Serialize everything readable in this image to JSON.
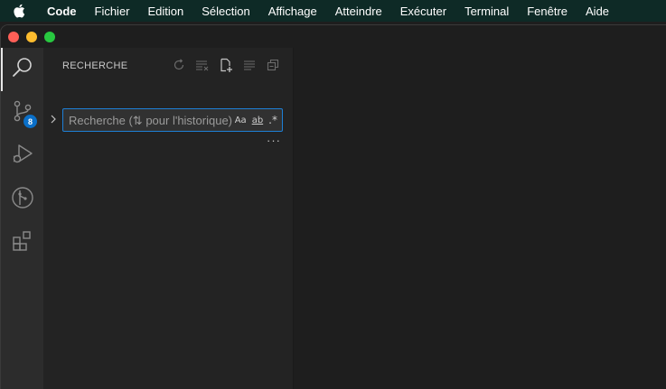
{
  "menubar": {
    "apple_icon": "apple-logo-icon",
    "items": [
      "Code",
      "Fichier",
      "Edition",
      "Sélection",
      "Affichage",
      "Atteindre",
      "Exécuter",
      "Terminal",
      "Fenêtre",
      "Aide"
    ]
  },
  "window": {
    "traffic_colors": {
      "close": "#ff5f57",
      "minimize": "#febc2e",
      "maximize": "#28c840"
    }
  },
  "activity_bar": {
    "items": [
      {
        "icon": "search-icon",
        "active": true
      },
      {
        "icon": "source-control-icon",
        "badge": "8"
      },
      {
        "icon": "run-debug-icon"
      },
      {
        "icon": "git-graph-icon"
      },
      {
        "icon": "extensions-icon"
      }
    ]
  },
  "sidebar": {
    "title": "RECHERCHE",
    "toolbar": [
      "refresh-icon",
      "clear-results-icon",
      "new-search-editor-icon",
      "view-as-tree-icon",
      "collapse-all-icon"
    ],
    "search": {
      "placeholder": "Recherche (⇅ pour l'historique)",
      "value": "",
      "match_case": "Aa",
      "whole_word": "ab",
      "regex": ".*"
    },
    "more_label": "···"
  },
  "colors": {
    "accent": "#1d7fd6",
    "badge": "#0a6fc8"
  }
}
